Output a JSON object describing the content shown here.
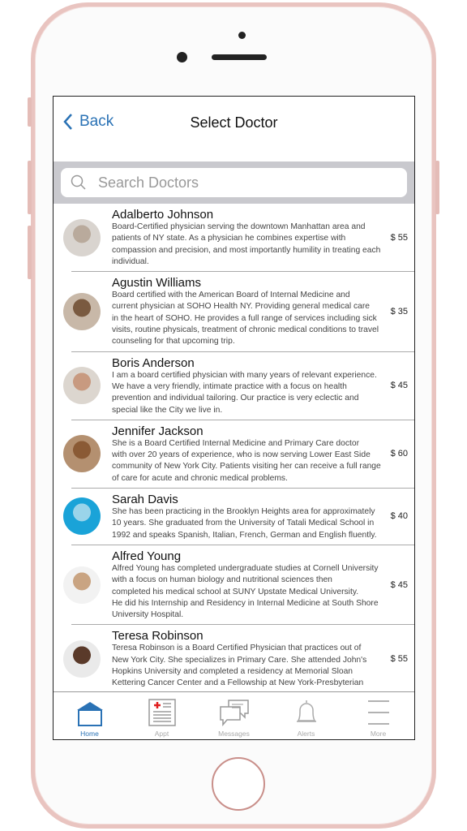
{
  "header": {
    "back_label": "Back",
    "title": "Select Doctor"
  },
  "search": {
    "placeholder": "Search Doctors"
  },
  "colors": {
    "accent": "#2a72b5",
    "frame": "#e9c4c0"
  },
  "doctors": [
    {
      "name": "Adalberto Johnson",
      "description": "Board-Certified physician serving the downtown Manhattan area and\npatients of NY state. As a physician he combines expertise with\ncompassion and precision, and most importantly humility in treating each\nindividual.",
      "price": "$ 55"
    },
    {
      "name": "Agustin Williams",
      "description": "Board certified with the American Board of Internal Medicine and\ncurrent physician at SOHO Health NY. Providing general medical care\nin the heart of SOHO. He provides a full range of services including sick\nvisits, routine physicals, treatment of chronic medical conditions to travel\ncounseling for that upcoming trip.",
      "price": "$ 35"
    },
    {
      "name": "Boris Anderson",
      "description": "I am a board certified physician with many years of relevant experience.\nWe have a very friendly, intimate practice with a focus on health\nprevention and individual tailoring. Our practice is very eclectic and\nspecial like the City we live in.",
      "price": "$ 45"
    },
    {
      "name": "Jennifer Jackson",
      "description": "She is a Board Certified Internal Medicine and Primary Care doctor\nwith over 20 years of experience, who is now serving Lower East Side\ncommunity of New York City. Patients visiting her can receive a full range\nof care for acute and chronic medical problems.",
      "price": "$ 60"
    },
    {
      "name": "Sarah Davis",
      "description": "She has been practicing in the Brooklyn Heights area for approximately\n10 years. She graduated from the University of Tatali Medical School in\n1992 and speaks Spanish, Italian, French, German and English fluently.\n ",
      "price": "$ 40"
    },
    {
      "name": "Alfred Young",
      "description": "Alfred Young has completed undergraduate studies at Cornell University\nwith a focus on human biology and nutritional sciences then\ncompleted his medical school at SUNY Upstate Medical University.\nHe did his Internship and Residency in Internal Medicine at South Shore\nUniversity Hospital.",
      "price": "$ 45"
    },
    {
      "name": "Teresa Robinson",
      "description": "Teresa Robinson is a Board Certified Physician that practices out of\nNew York City. She specializes in Primary Care. She attended John's\nHopkins University and completed a residency at Memorial Sloan\nKettering Cancer Center and a Fellowship at New York-Presbyterian",
      "price": "$ 55"
    }
  ],
  "tabs": [
    {
      "label": "Home",
      "icon": "home-icon",
      "active": true
    },
    {
      "label": "Appt",
      "icon": "appointment-icon",
      "active": false
    },
    {
      "label": "Messages",
      "icon": "messages-icon",
      "active": false
    },
    {
      "label": "Alerts",
      "icon": "bell-icon",
      "active": false
    },
    {
      "label": "More",
      "icon": "menu-icon",
      "active": false
    }
  ]
}
